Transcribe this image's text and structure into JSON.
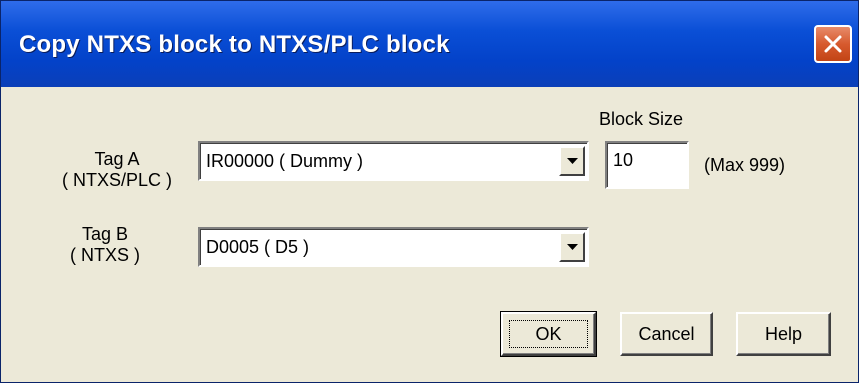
{
  "window": {
    "title": "Copy NTXS block to NTXS/PLC block"
  },
  "tag_a": {
    "label_line1": "Tag A",
    "label_line2": "( NTXS/PLC )",
    "value": "IR00000 ( Dummy )"
  },
  "tag_b": {
    "label_line1": "Tag B",
    "label_line2": "( NTXS )",
    "value": "D0005 ( D5 )"
  },
  "block_size": {
    "label": "Block Size",
    "value": "10",
    "max_note": "(Max 999)"
  },
  "buttons": {
    "ok": "OK",
    "cancel": "Cancel",
    "help": "Help"
  },
  "icons": {
    "close": "close-icon",
    "dropdown": "chevron-down-icon"
  }
}
